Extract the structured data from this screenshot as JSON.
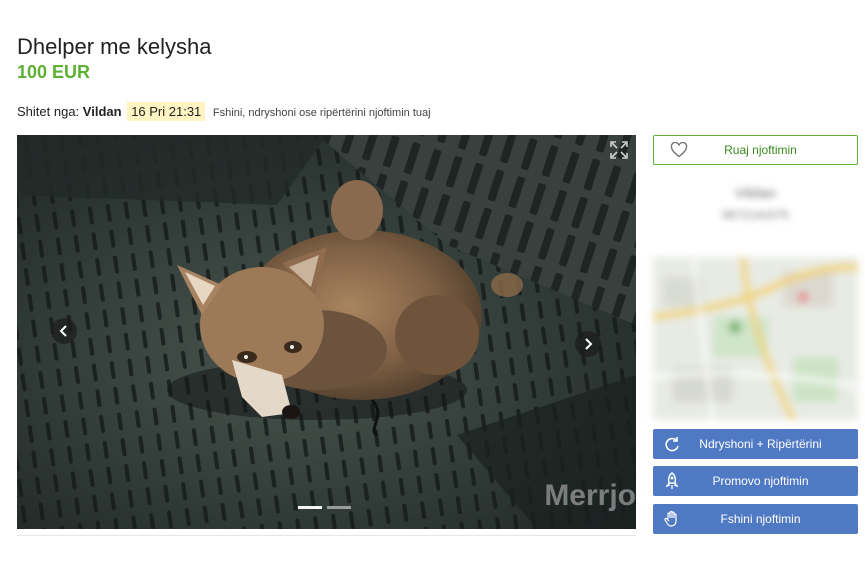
{
  "listing": {
    "title": "Dhelper me kelysha",
    "price": "100 EUR",
    "seller_label": "Shitet nga:",
    "seller_name": "Vildan",
    "date": "16 Pri 21:31",
    "edit_hint": "Fshini, ndryshoni ose ripërtërini njoftimin tuaj"
  },
  "gallery": {
    "watermark": "Merrjo",
    "prev_icon": "chevron-left-icon",
    "next_icon": "chevron-right-icon",
    "expand_icon": "expand-icon",
    "slide_count": 2,
    "active_slide": 1
  },
  "sidebar": {
    "save_label": "Ruaj njoftimin",
    "save_icon": "heart-icon",
    "contact_name": "Vildan",
    "contact_phone": "0672141575",
    "buttons": [
      {
        "label": "Ndryshoni + Ripërtërini",
        "icon": "refresh-icon"
      },
      {
        "label": "Promovo njoftimin",
        "icon": "rocket-icon"
      },
      {
        "label": "Fshini njoftimin",
        "icon": "hand-icon"
      }
    ]
  },
  "colors": {
    "price_green": "#5cb032",
    "button_blue": "#4f79c2",
    "date_highlight": "#fff4c2"
  }
}
